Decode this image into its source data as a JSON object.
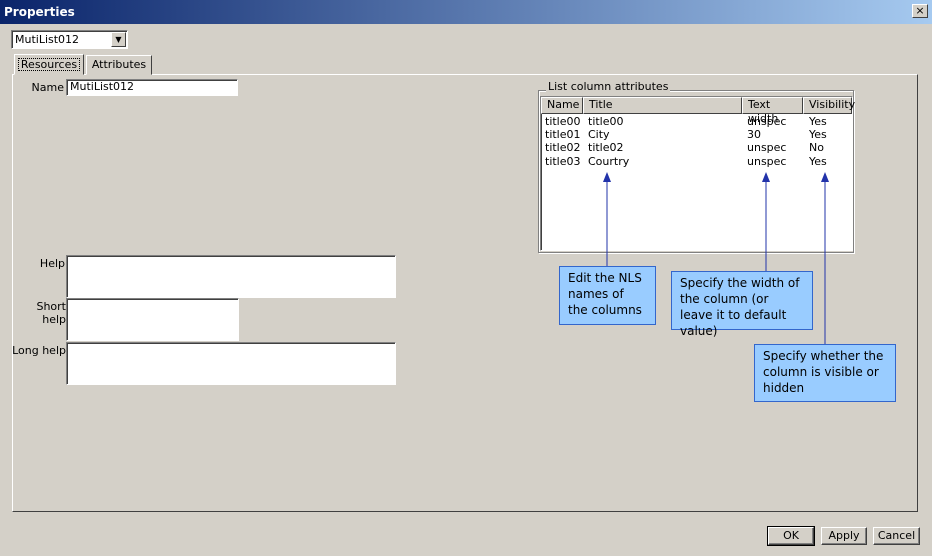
{
  "window": {
    "title": "Properties",
    "close_glyph": "×"
  },
  "selector": {
    "value": "MutiList012",
    "arrow_glyph": "▼"
  },
  "tabs": [
    {
      "label": "Resources",
      "active": true
    },
    {
      "label": "Attributes",
      "active": false
    }
  ],
  "form": {
    "name_label": "Name",
    "name_value": "MutiList012",
    "help_label": "Help",
    "short_help_label": "Short help",
    "long_help_label": "Long help"
  },
  "columns_group": {
    "legend": "List column attributes",
    "headers": [
      "Name",
      "Title",
      "Text width",
      "Visibility"
    ],
    "rows": [
      [
        "title00",
        "title00",
        "unspec",
        "Yes"
      ],
      [
        "title01",
        "City",
        "30",
        "Yes"
      ],
      [
        "title02",
        "title02",
        "unspec",
        "No"
      ],
      [
        "title03",
        "Courtry",
        "unspec",
        "Yes"
      ]
    ]
  },
  "callouts": {
    "nls": "Edit the NLS names of the columns",
    "width": "Specify the width of the column (or leave it to default value)",
    "visibility": "Specify whether the column is visible or hidden"
  },
  "buttons": {
    "ok": "OK",
    "apply": "Apply",
    "cancel": "Cancel"
  },
  "colors": {
    "callout_fill": "#99ccff",
    "arrow": "#2233aa",
    "title_bar": "#0a246a"
  }
}
